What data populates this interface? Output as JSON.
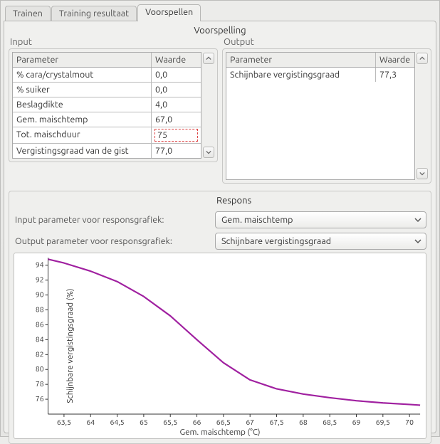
{
  "tabs": {
    "train": "Trainen",
    "result": "Training resultaat",
    "predict": "Voorspellen"
  },
  "prediction": {
    "title": "Voorspelling",
    "input": {
      "label": "Input",
      "headers": {
        "param": "Parameter",
        "value": "Waarde"
      },
      "rows": [
        {
          "param": "% cara/crystalmout",
          "value": "0,0"
        },
        {
          "param": "% suiker",
          "value": "0,0"
        },
        {
          "param": "Beslagdikte",
          "value": "4,0"
        },
        {
          "param": "Gem. maischtemp",
          "value": "67,0"
        },
        {
          "param": "Tot. maischduur",
          "value": "75",
          "editing": true
        },
        {
          "param": "Vergistingsgraad van de gist",
          "value": "77,0"
        }
      ]
    },
    "output": {
      "label": "Output",
      "headers": {
        "param": "Parameter",
        "value": "Waarde"
      },
      "rows": [
        {
          "param": "Schijnbare vergistingsgraad",
          "value": "77,3"
        }
      ]
    }
  },
  "respons": {
    "title": "Respons",
    "input_label": "Input parameter voor responsgrafiek:",
    "output_label": "Output parameter voor responsgrafiek:",
    "input_value": "Gem. maischtemp",
    "output_value": "Schijnbare vergistingsgraad"
  },
  "chart_data": {
    "type": "line",
    "xlabel": "Gem. maischtemp (°C)",
    "ylabel": "Schijnbare vergistingsgraad (%)",
    "xlim": [
      63.2,
      70.2
    ],
    "ylim": [
      74,
      95
    ],
    "xticks": [
      63.5,
      64,
      64.5,
      65,
      65.5,
      66,
      66.5,
      67,
      67.5,
      68,
      68.5,
      69,
      69.5,
      70
    ],
    "xtick_labels": [
      "63,5",
      "64",
      "64,5",
      "65",
      "65,5",
      "66",
      "66,5",
      "67",
      "67,5",
      "68",
      "68,5",
      "69",
      "69,5",
      "70"
    ],
    "yticks": [
      76,
      78,
      80,
      82,
      84,
      86,
      88,
      90,
      92,
      94
    ],
    "series": [
      {
        "name": "Schijnbare vergistingsgraad",
        "color": "#a020a0",
        "x": [
          63.2,
          63.5,
          64.0,
          64.5,
          65.0,
          65.5,
          66.0,
          66.5,
          67.0,
          67.5,
          68.0,
          68.5,
          69.0,
          69.5,
          70.0,
          70.2
        ],
        "y": [
          94.8,
          94.3,
          93.2,
          91.8,
          89.8,
          87.2,
          84.0,
          80.9,
          78.6,
          77.4,
          76.7,
          76.2,
          75.8,
          75.5,
          75.3,
          75.2
        ]
      }
    ]
  }
}
